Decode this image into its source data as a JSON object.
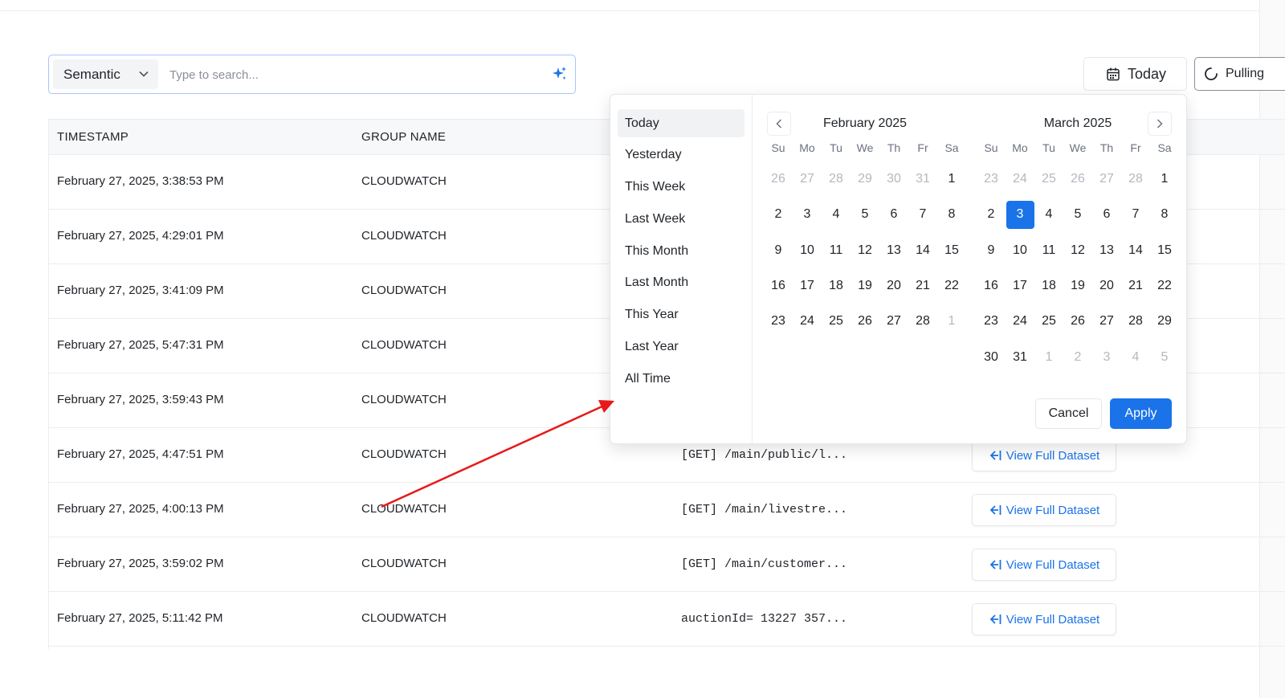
{
  "search": {
    "mode": "Semantic",
    "placeholder": "Type to search...",
    "value": ""
  },
  "header": {
    "date_button": "Today",
    "pulling_button": "Pulling"
  },
  "table": {
    "columns": [
      "TIMESTAMP",
      "GROUP NAME"
    ],
    "rows": [
      {
        "timestamp": "February 27, 2025, 3:38:53 PM",
        "group": "CLOUDWATCH",
        "message": "",
        "action": ""
      },
      {
        "timestamp": "February 27, 2025, 4:29:01 PM",
        "group": "CLOUDWATCH",
        "message": "",
        "action": ""
      },
      {
        "timestamp": "February 27, 2025, 3:41:09 PM",
        "group": "CLOUDWATCH",
        "message": "",
        "action": ""
      },
      {
        "timestamp": "February 27, 2025, 5:47:31 PM",
        "group": "CLOUDWATCH",
        "message": "",
        "action": ""
      },
      {
        "timestamp": "February 27, 2025, 3:59:43 PM",
        "group": "CLOUDWATCH",
        "message": "",
        "action": ""
      },
      {
        "timestamp": "February 27, 2025, 4:47:51 PM",
        "group": "CLOUDWATCH",
        "message": "[GET] /main/public/l...",
        "action": "View Full Dataset"
      },
      {
        "timestamp": "February 27, 2025, 4:00:13 PM",
        "group": "CLOUDWATCH",
        "message": "[GET] /main/livestre...",
        "action": "View Full Dataset"
      },
      {
        "timestamp": "February 27, 2025, 3:59:02 PM",
        "group": "CLOUDWATCH",
        "message": "[GET] /main/customer...",
        "action": "View Full Dataset"
      },
      {
        "timestamp": "February 27, 2025, 5:11:42 PM",
        "group": "CLOUDWATCH",
        "message": "auctionId= 13227 357...",
        "action": "View Full Dataset"
      }
    ]
  },
  "date_picker": {
    "presets": [
      "Today",
      "Yesterday",
      "This Week",
      "Last Week",
      "This Month",
      "Last Month",
      "This Year",
      "Last Year",
      "All Time"
    ],
    "active_preset": "Today",
    "weekdays": [
      "Su",
      "Mo",
      "Tu",
      "We",
      "Th",
      "Fr",
      "Sa"
    ],
    "months": [
      {
        "title": "February 2025",
        "days": [
          {
            "d": "26",
            "muted": true
          },
          {
            "d": "27",
            "muted": true
          },
          {
            "d": "28",
            "muted": true
          },
          {
            "d": "29",
            "muted": true
          },
          {
            "d": "30",
            "muted": true
          },
          {
            "d": "31",
            "muted": true
          },
          {
            "d": "1"
          },
          {
            "d": "2"
          },
          {
            "d": "3"
          },
          {
            "d": "4"
          },
          {
            "d": "5"
          },
          {
            "d": "6"
          },
          {
            "d": "7"
          },
          {
            "d": "8"
          },
          {
            "d": "9"
          },
          {
            "d": "10"
          },
          {
            "d": "11"
          },
          {
            "d": "12"
          },
          {
            "d": "13"
          },
          {
            "d": "14"
          },
          {
            "d": "15"
          },
          {
            "d": "16"
          },
          {
            "d": "17"
          },
          {
            "d": "18"
          },
          {
            "d": "19"
          },
          {
            "d": "20"
          },
          {
            "d": "21"
          },
          {
            "d": "22"
          },
          {
            "d": "23"
          },
          {
            "d": "24"
          },
          {
            "d": "25"
          },
          {
            "d": "26"
          },
          {
            "d": "27"
          },
          {
            "d": "28"
          },
          {
            "d": "1",
            "muted": true
          }
        ]
      },
      {
        "title": "March 2025",
        "days": [
          {
            "d": "23",
            "muted": true
          },
          {
            "d": "24",
            "muted": true
          },
          {
            "d": "25",
            "muted": true
          },
          {
            "d": "26",
            "muted": true
          },
          {
            "d": "27",
            "muted": true
          },
          {
            "d": "28",
            "muted": true
          },
          {
            "d": "1"
          },
          {
            "d": "2"
          },
          {
            "d": "3",
            "selected": true
          },
          {
            "d": "4"
          },
          {
            "d": "5"
          },
          {
            "d": "6"
          },
          {
            "d": "7"
          },
          {
            "d": "8"
          },
          {
            "d": "9"
          },
          {
            "d": "10"
          },
          {
            "d": "11"
          },
          {
            "d": "12"
          },
          {
            "d": "13"
          },
          {
            "d": "14"
          },
          {
            "d": "15"
          },
          {
            "d": "16"
          },
          {
            "d": "17"
          },
          {
            "d": "18"
          },
          {
            "d": "19"
          },
          {
            "d": "20"
          },
          {
            "d": "21"
          },
          {
            "d": "22"
          },
          {
            "d": "23"
          },
          {
            "d": "24"
          },
          {
            "d": "25"
          },
          {
            "d": "26"
          },
          {
            "d": "27"
          },
          {
            "d": "28"
          },
          {
            "d": "29"
          },
          {
            "d": "30"
          },
          {
            "d": "31"
          },
          {
            "d": "1",
            "muted": true
          },
          {
            "d": "2",
            "muted": true
          },
          {
            "d": "3",
            "muted": true
          },
          {
            "d": "4",
            "muted": true
          },
          {
            "d": "5",
            "muted": true
          }
        ]
      }
    ],
    "cancel_label": "Cancel",
    "apply_label": "Apply"
  },
  "colors": {
    "accent": "#1a73e8",
    "annotation_arrow": "#e8191a"
  },
  "icons": {
    "mode_chevron": "chevron-down-icon",
    "ai_search": "sparkle-icon",
    "date": "calendar-icon",
    "pulling": "spinner-icon",
    "view_dataset": "arrow-left-bar-icon",
    "prev_month": "chevron-left-icon",
    "next_month": "chevron-right-icon"
  }
}
